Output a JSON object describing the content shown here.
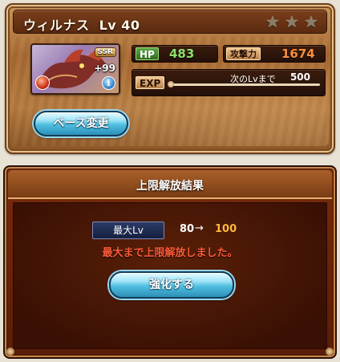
{
  "character": {
    "name": "ウィルナス",
    "level_label": "Lv 40",
    "rarity": "SSR",
    "plus": "+99",
    "stars": 3
  },
  "stats": {
    "hp_label": "HP",
    "hp_value": "483",
    "atk_label": "攻撃力",
    "atk_value": "1674",
    "exp_label": "EXP",
    "next_level_label": "次のLvまで",
    "next_level_value": "500"
  },
  "buttons": {
    "change_base": "ベース変更",
    "upgrade": "強化する"
  },
  "result": {
    "title": "上限解放結果",
    "max_lv_label": "最大Lv",
    "from_level": "80",
    "arrow": "→",
    "to_level": "100",
    "message": "最大まで上限解放しました。"
  },
  "colors": {
    "hp": "#8fe06a",
    "atk": "#ff8d3a",
    "new_level": "#ffb840",
    "message": "#ff5a3a"
  },
  "icons": {
    "element": "fire-element-icon",
    "info": "info-icon",
    "star": "star-icon"
  }
}
